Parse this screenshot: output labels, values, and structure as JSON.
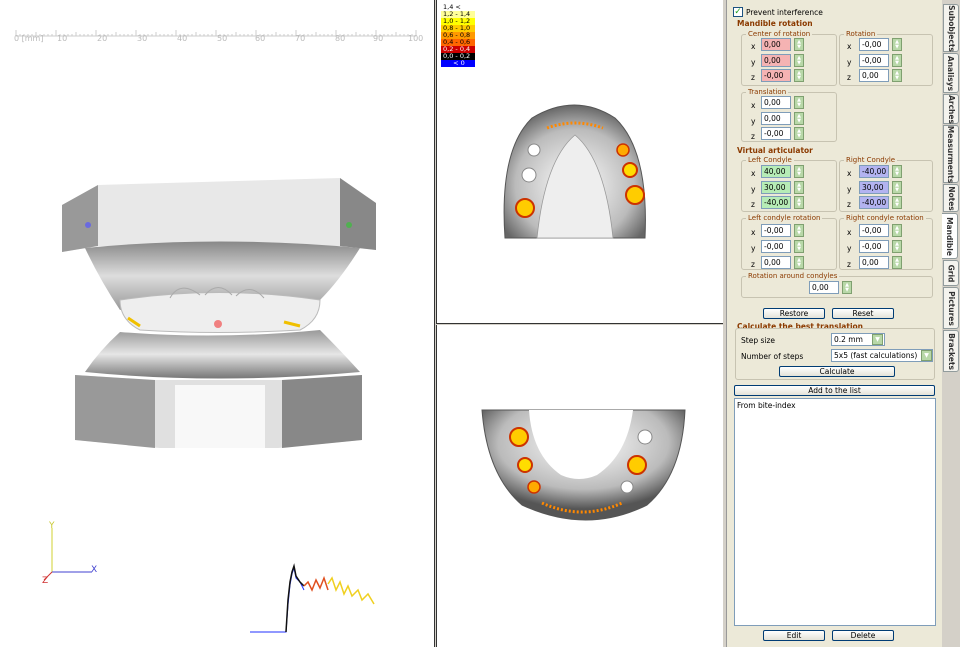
{
  "viewport3d": {
    "ruler_labels": [
      "0 [mm]",
      "10",
      "20",
      "30",
      "40",
      "50",
      "60",
      "70",
      "80",
      "90",
      "100"
    ],
    "axis_x": "X",
    "axis_y": "Y",
    "axis_z": "Z"
  },
  "legend": {
    "items": [
      {
        "label": "1,4 <",
        "color": "#ffffff"
      },
      {
        "label": "1,2 - 1,4",
        "color": "#ffff99"
      },
      {
        "label": "1,0 - 1,2",
        "color": "#ffff00"
      },
      {
        "label": "0,8 - 1,0",
        "color": "#ffcc00"
      },
      {
        "label": "0,6 - 0,8",
        "color": "#ff9900"
      },
      {
        "label": "0,4 - 0,6",
        "color": "#ff6600"
      },
      {
        "label": "0,2 - 0,4",
        "color": "#cc0000"
      },
      {
        "label": "0,0 - 0,2",
        "color": "#000000"
      },
      {
        "label": "< 0",
        "color": "#0000ff"
      }
    ]
  },
  "panel": {
    "prevent_label": "Prevent interference",
    "mandible_rotation": "Mandible rotation",
    "center_of_rotation": "Center of rotation",
    "rotation": "Rotation",
    "translation": "Translation",
    "axes": [
      "x",
      "y",
      "z"
    ],
    "cor_values": [
      "0,00",
      "0,00",
      "-0,00"
    ],
    "rot_values": [
      "-0,00",
      "-0,00",
      "0,00"
    ],
    "trans_values": [
      "0,00",
      "0,00",
      "-0,00"
    ],
    "virtual_articulator": "Virtual articulator",
    "left_condyle": "Left Condyle",
    "right_condyle": "Right Condyle",
    "left_condyle_values": [
      "40,00",
      "30,00",
      "-40,00"
    ],
    "right_condyle_values": [
      "-40,00",
      "30,00",
      "-40,00"
    ],
    "left_condyle_rotation": "Left condyle rotation",
    "right_condyle_rotation": "Right condyle rotation",
    "lcr_values": [
      "-0,00",
      "-0,00",
      "0,00"
    ],
    "rcr_values": [
      "-0,00",
      "-0,00",
      "0,00"
    ],
    "rotation_around_condyles": "Rotation around condyles",
    "rac_value": "0,00",
    "restore": "Restore",
    "reset": "Reset",
    "calc_best": "Calculate the best translation",
    "step_size_label": "Step size",
    "step_size_value": "0.2 mm",
    "num_steps_label": "Number of steps",
    "num_steps_value": "5x5  (fast calculations)",
    "calculate": "Calculate",
    "add_to_list": "Add to the list",
    "list_items": [
      "From bite-index"
    ],
    "edit": "Edit",
    "delete": "Delete"
  },
  "tabs": [
    "Subobjects",
    "Analisys",
    "Arches",
    "Measurments",
    "Notes",
    "Mandible",
    "Grid",
    "Pictures",
    "Brackets"
  ],
  "colors": {
    "accent": "#8b3a00",
    "panel": "#ece9d8"
  }
}
